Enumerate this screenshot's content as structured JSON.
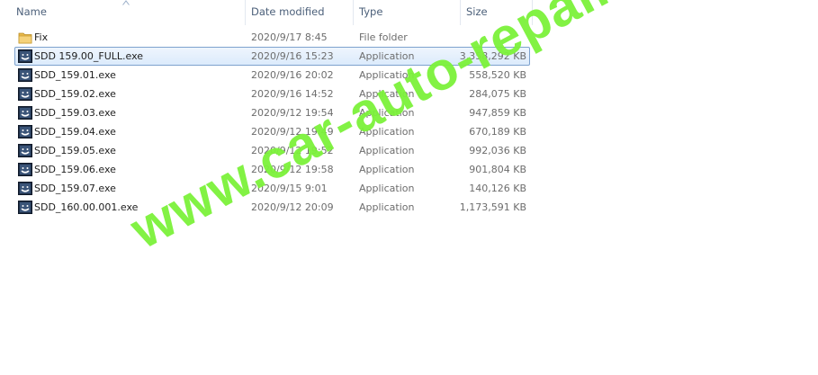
{
  "columns": {
    "name": "Name",
    "date": "Date modified",
    "type": "Type",
    "size": "Size"
  },
  "files": [
    {
      "name": "Fix",
      "date": "2020/9/17 8:45",
      "type": "File folder",
      "size": "",
      "icon": "folder-icon"
    },
    {
      "name": "SDD 159.00_FULL.exe",
      "date": "2020/9/16 15:23",
      "type": "Application",
      "size": "3,358,292 KB",
      "icon": "application-icon",
      "selected": true
    },
    {
      "name": "SDD_159.01.exe",
      "date": "2020/9/16 20:02",
      "type": "Application",
      "size": "558,520 KB",
      "icon": "application-icon"
    },
    {
      "name": "SDD_159.02.exe",
      "date": "2020/9/16 14:52",
      "type": "Application",
      "size": "284,075 KB",
      "icon": "application-icon"
    },
    {
      "name": "SDD_159.03.exe",
      "date": "2020/9/12 19:54",
      "type": "Application",
      "size": "947,859 KB",
      "icon": "application-icon"
    },
    {
      "name": "SDD_159.04.exe",
      "date": "2020/9/12 19:49",
      "type": "Application",
      "size": "670,189 KB",
      "icon": "application-icon"
    },
    {
      "name": "SDD_159.05.exe",
      "date": "2020/9/12 19:52",
      "type": "Application",
      "size": "992,036 KB",
      "icon": "application-icon"
    },
    {
      "name": "SDD_159.06.exe",
      "date": "2020/9/12 19:58",
      "type": "Application",
      "size": "901,804 KB",
      "icon": "application-icon"
    },
    {
      "name": "SDD_159.07.exe",
      "date": "2020/9/15 9:01",
      "type": "Application",
      "size": "140,126 KB",
      "icon": "application-icon"
    },
    {
      "name": "SDD_160.00.001.exe",
      "date": "2020/9/12 20:09",
      "type": "Application",
      "size": "1,173,591 KB",
      "icon": "application-icon"
    }
  ],
  "watermark": "www.car-auto-repair.com",
  "colors": {
    "selection_border": "#7da2ce",
    "watermark": "#7cf23a",
    "header_text": "#4c607a"
  }
}
